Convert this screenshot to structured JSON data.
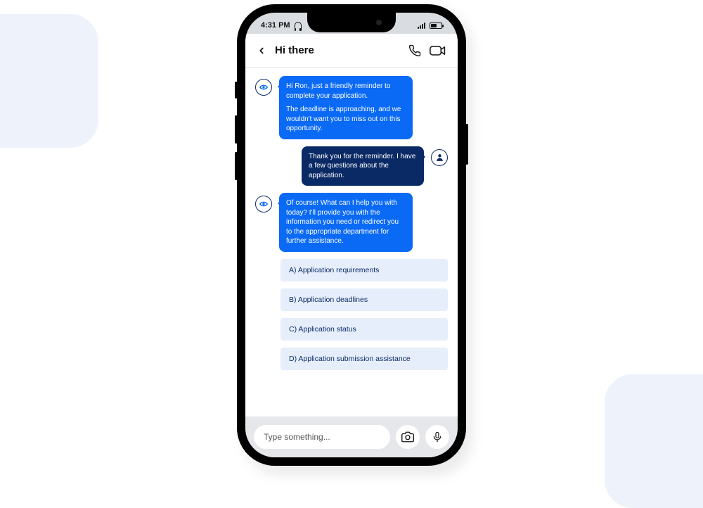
{
  "status_bar": {
    "time": "4:31 PM"
  },
  "header": {
    "title": "Hi there"
  },
  "messages": {
    "bot1_p1": "Hi Ron, just a friendly reminder to complete your application.",
    "bot1_p2": "The deadline is approaching, and we wouldn't want you to miss out on this opportunity.",
    "user1": "Thank you for the reminder. I have a few questions about the application.",
    "bot2": "Of course! What can I help you with today? I'll provide you with the information you need or redirect you to the appropriate department for further assistance."
  },
  "options": [
    "A) Application requirements",
    "B) Application deadlines",
    "C) Application status",
    "D) Application submission assistance"
  ],
  "input": {
    "placeholder": "Type something..."
  },
  "colors": {
    "bot_bubble": "#0a6af5",
    "user_bubble": "#0a2a66",
    "option_bg": "#e6edfb"
  }
}
